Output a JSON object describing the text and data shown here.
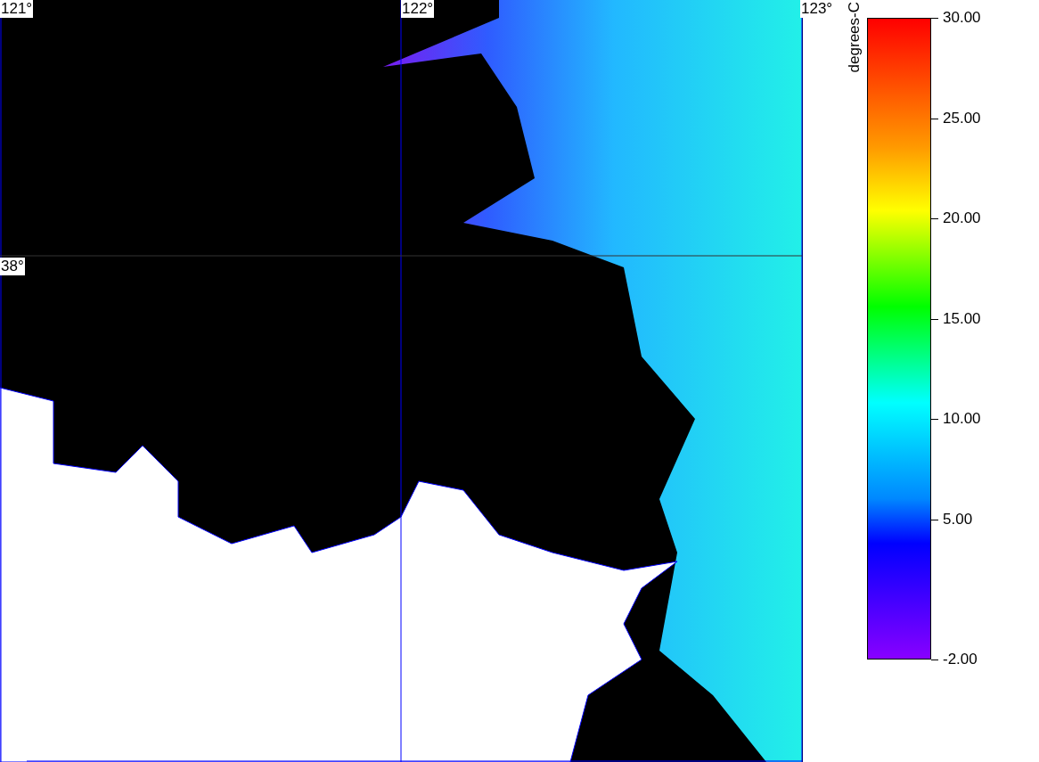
{
  "map": {
    "longitude_labels": [
      "121°",
      "122°",
      "123°"
    ],
    "latitude_labels": [
      "38°"
    ]
  },
  "colorbar": {
    "unit": "degrees-C",
    "ticks": [
      "30.00",
      "25.00",
      "20.00",
      "15.00",
      "10.00",
      "5.00",
      "-2.00"
    ]
  }
}
